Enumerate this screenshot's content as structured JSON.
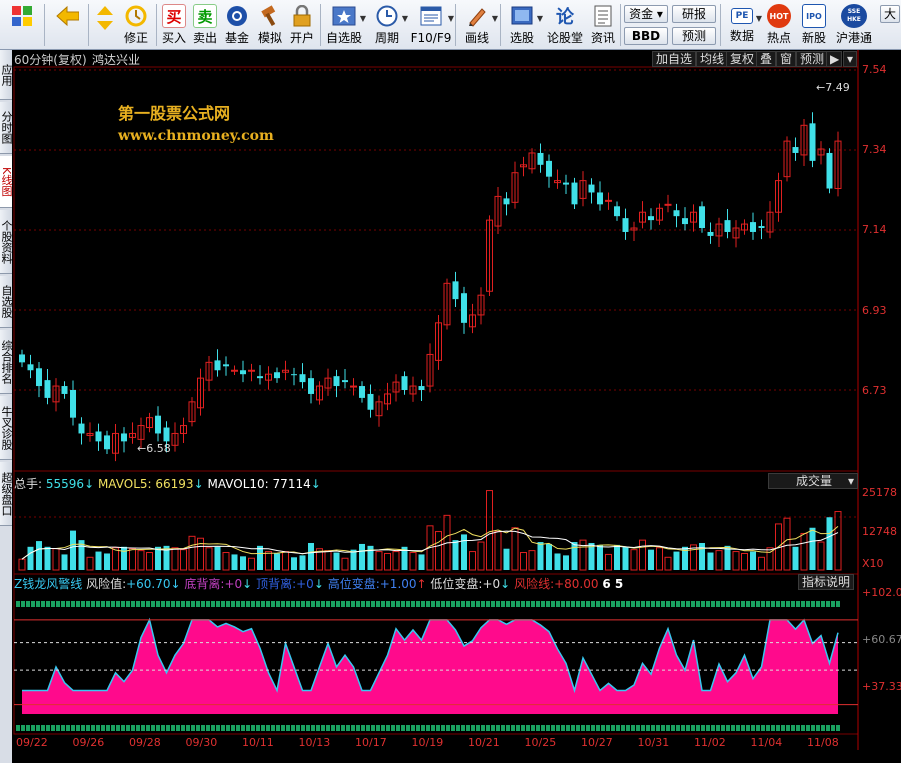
{
  "toolbar": {
    "items": [
      {
        "id": "home",
        "label": ""
      },
      {
        "id": "back",
        "label": ""
      },
      {
        "id": "updown",
        "label": "修正"
      },
      {
        "id": "buy",
        "label": "买入",
        "icon": "买"
      },
      {
        "id": "sell",
        "label": "卖出",
        "icon": "卖"
      },
      {
        "id": "fund",
        "label": "基金"
      },
      {
        "id": "sim",
        "label": "模拟"
      },
      {
        "id": "open",
        "label": "开户"
      },
      {
        "id": "fav",
        "label": "自选股"
      },
      {
        "id": "period",
        "label": "周期"
      },
      {
        "id": "f10",
        "label": "F10/F9"
      },
      {
        "id": "draw",
        "label": "画线"
      },
      {
        "id": "pick",
        "label": "选股"
      },
      {
        "id": "forum",
        "label": "论股堂"
      },
      {
        "id": "info",
        "label": "资讯"
      },
      {
        "id": "data",
        "label": "数据"
      },
      {
        "id": "hot",
        "label": "热点"
      },
      {
        "id": "newipo",
        "label": "新股"
      },
      {
        "id": "hk",
        "label": "沪港通"
      },
      {
        "id": "big",
        "label": "大"
      }
    ],
    "zijin": "资金",
    "bbd": "BBD",
    "yanbao": "研报",
    "yuce": "预测",
    "pe": "PE",
    "hot_icon": "HOT",
    "ipo_icon": "IPO",
    "hk_icon": "SSE HKE"
  },
  "left_tabs": [
    "应用",
    "分时图",
    "K线图",
    "个股资料",
    "自选股",
    "综合排名",
    "牛叉诊股",
    "超级盘口"
  ],
  "price_panel": {
    "title": "60分钟(复权)",
    "stock": "鸿达兴业",
    "buttons": [
      "加自选",
      "均线",
      "复权",
      "叠",
      "窗",
      "预测"
    ],
    "high_label": "7.49",
    "low_label": "6.58",
    "y_labels": [
      "7.54",
      "7.34",
      "7.14",
      "6.93",
      "6.73"
    ]
  },
  "watermark": {
    "line1": "第一股票公式网",
    "line2": "www.chnmoney.com"
  },
  "volume_panel": {
    "total_label": "总手:",
    "total_value": "55596",
    "mavol5_label": "MAVOL5:",
    "mavol5_value": "66193",
    "mavol10_label": "MAVOL10:",
    "mavol10_value": "77114",
    "selector": "成交量",
    "y_labels": [
      "25178",
      "12748"
    ],
    "unit": "X10"
  },
  "indicator_panel": {
    "name": "Z钱龙风警线",
    "items": [
      {
        "label": "风险值:",
        "value": "+60.70",
        "arrow": "↓",
        "color": "#38c8f0"
      },
      {
        "label": "底背离:",
        "value": "+0",
        "arrow": "↓",
        "color": "#c040c0"
      },
      {
        "label": "顶背离:",
        "value": "+0",
        "arrow": "↓",
        "color": "#3060e0"
      },
      {
        "label": "高位变盘:",
        "value": "+1.00",
        "arrow": "↑",
        "color": "#4080f0"
      },
      {
        "label": "低位变盘:",
        "value": "+0",
        "arrow": "↓",
        "color": "#dddddd"
      },
      {
        "label": "风险线:",
        "value": "+80.00",
        "arrow": "",
        "color": "#e03030"
      }
    ],
    "extra": "6 5",
    "help": "指标说明",
    "y_labels": [
      "+102.0",
      "+60.67",
      "+37.33"
    ]
  },
  "x_axis": [
    "09/22",
    "09/26",
    "09/28",
    "09/30",
    "10/11",
    "10/13",
    "10/17",
    "10/19",
    "10/21",
    "10/25",
    "10/27",
    "10/31",
    "11/02",
    "11/04",
    "11/08"
  ],
  "colors": {
    "up": "#e02020",
    "down": "#40e0e8",
    "risk_fill": "#ff0a8c",
    "risk_line": "#38c8f0",
    "grid": "#7a0000"
  },
  "chart_data": {
    "type": "candlestick",
    "series": [
      {
        "name": "price_close",
        "values": [
          6.8,
          6.78,
          6.74,
          6.71,
          6.74,
          6.72,
          6.66,
          6.62,
          6.62,
          6.6,
          6.58,
          6.62,
          6.6,
          6.62,
          6.64,
          6.66,
          6.62,
          6.6,
          6.62,
          6.64,
          6.7,
          6.76,
          6.8,
          6.78,
          6.79,
          6.78,
          6.77,
          6.78,
          6.76,
          6.77,
          6.76,
          6.78,
          6.77,
          6.75,
          6.72,
          6.74,
          6.76,
          6.74,
          6.75,
          6.74,
          6.71,
          6.68,
          6.7,
          6.72,
          6.75,
          6.73,
          6.74,
          6.73,
          6.82,
          6.9,
          7.0,
          6.96,
          6.9,
          6.92,
          6.97,
          7.16,
          7.22,
          7.2,
          7.28,
          7.3,
          7.33,
          7.3,
          7.27,
          7.26,
          7.25,
          7.2,
          7.26,
          7.23,
          7.2,
          7.21,
          7.17,
          7.13,
          7.14,
          7.18,
          7.16,
          7.19,
          7.2,
          7.17,
          7.15,
          7.18,
          7.14,
          7.12,
          7.15,
          7.13,
          7.14,
          7.15,
          7.13,
          7.14,
          7.18,
          7.26,
          7.36,
          7.33,
          7.4,
          7.31,
          7.34,
          7.24,
          7.36
        ]
      }
    ],
    "volume_max": 25178,
    "risk_line": 80,
    "risk_ylim": [
      0,
      102
    ]
  }
}
